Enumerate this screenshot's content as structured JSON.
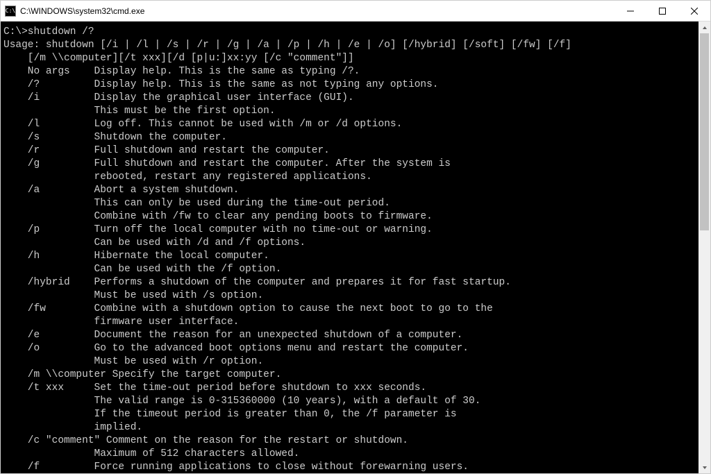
{
  "window": {
    "title": "C:\\WINDOWS\\system32\\cmd.exe",
    "icon_name": "cmd-icon",
    "controls": {
      "minimize": "minimize",
      "maximize": "maximize",
      "close": "close"
    }
  },
  "terminal": {
    "prompt_line": "C:\\>shutdown /?",
    "usage_line1": "Usage: shutdown [/i | /l | /s | /r | /g | /a | /p | /h | /e | /o] [/hybrid] [/soft] [/fw] [/f]",
    "usage_line2": "    [/m \\\\computer][/t xxx][/d [p|u:]xx:yy [/c \"comment\"]]",
    "blank": "",
    "l01": "    No args    Display help. This is the same as typing /?.",
    "l02": "    /?         Display help. This is the same as not typing any options.",
    "l03": "    /i         Display the graphical user interface (GUI).",
    "l04": "               This must be the first option.",
    "l05": "    /l         Log off. This cannot be used with /m or /d options.",
    "l06": "    /s         Shutdown the computer.",
    "l07": "    /r         Full shutdown and restart the computer.",
    "l08": "    /g         Full shutdown and restart the computer. After the system is",
    "l09": "               rebooted, restart any registered applications.",
    "l10": "    /a         Abort a system shutdown.",
    "l11": "               This can only be used during the time-out period.",
    "l12": "               Combine with /fw to clear any pending boots to firmware.",
    "l13": "    /p         Turn off the local computer with no time-out or warning.",
    "l14": "               Can be used with /d and /f options.",
    "l15": "    /h         Hibernate the local computer.",
    "l16": "               Can be used with the /f option.",
    "l17": "    /hybrid    Performs a shutdown of the computer and prepares it for fast startup.",
    "l18": "               Must be used with /s option.",
    "l19": "    /fw        Combine with a shutdown option to cause the next boot to go to the",
    "l20": "               firmware user interface.",
    "l21": "    /e         Document the reason for an unexpected shutdown of a computer.",
    "l22": "    /o         Go to the advanced boot options menu and restart the computer.",
    "l23": "               Must be used with /r option.",
    "l24": "    /m \\\\computer Specify the target computer.",
    "l25": "    /t xxx     Set the time-out period before shutdown to xxx seconds.",
    "l26": "               The valid range is 0-315360000 (10 years), with a default of 30.",
    "l27": "               If the timeout period is greater than 0, the /f parameter is",
    "l28": "               implied.",
    "l29": "    /c \"comment\" Comment on the reason for the restart or shutdown.",
    "l30": "               Maximum of 512 characters allowed.",
    "l31": "    /f         Force running applications to close without forewarning users."
  }
}
